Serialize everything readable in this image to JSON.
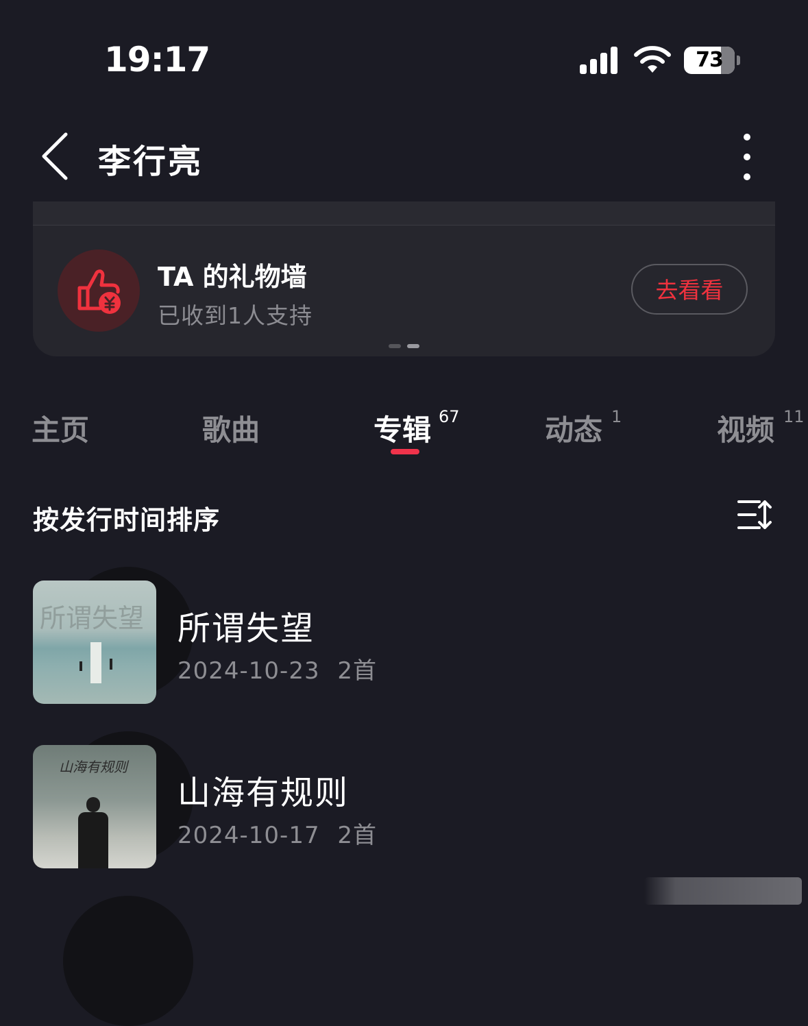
{
  "status_bar": {
    "time": "19:17",
    "battery": "73",
    "battery_level": 0.73
  },
  "nav": {
    "title": "李行亮"
  },
  "gift_card": {
    "title": "TA 的礼物墙",
    "subtitle": "已收到1人支持",
    "button": "去看看"
  },
  "tabs": [
    {
      "label": "主页",
      "count": ""
    },
    {
      "label": "歌曲",
      "count": ""
    },
    {
      "label": "专辑",
      "count": "67"
    },
    {
      "label": "动态",
      "count": "1"
    },
    {
      "label": "视频",
      "count": "11"
    }
  ],
  "active_tab": "专辑",
  "sort": {
    "label": "按发行时间排序"
  },
  "albums": [
    {
      "name": "所谓失望",
      "date": "2024-10-23",
      "tracks": "2首",
      "cover_text": "所谓失望"
    },
    {
      "name": "山海有规则",
      "date": "2024-10-17",
      "tracks": "2首",
      "cover_text": "山海有规则"
    }
  ],
  "colors": {
    "background": "#1b1b24",
    "accent": "#f0334b",
    "button_text": "#f0323e"
  }
}
